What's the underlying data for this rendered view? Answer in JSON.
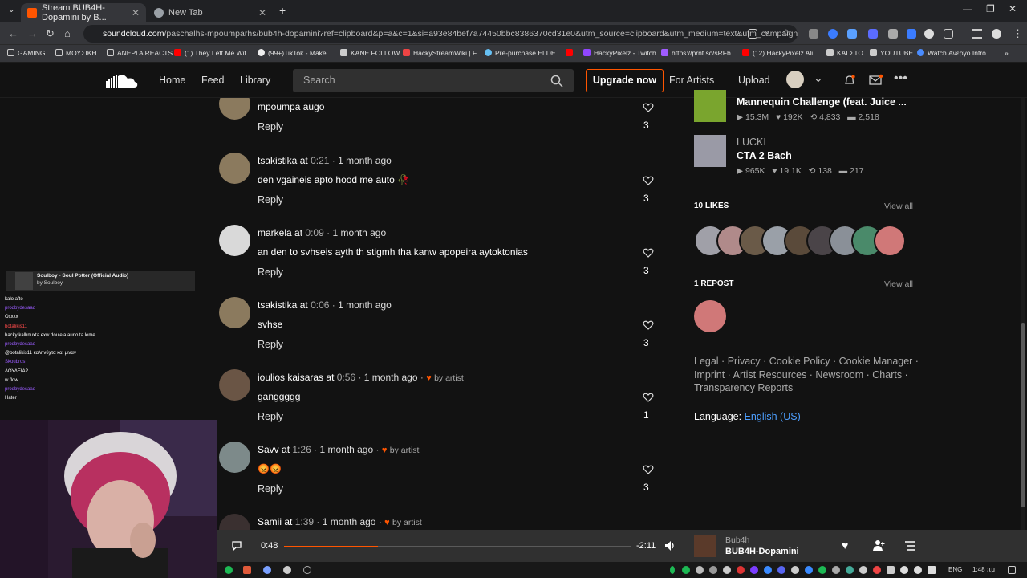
{
  "browser": {
    "tabs": [
      {
        "title": "Stream BUB4H-Dopamini by B...",
        "color": "#ff5500"
      },
      {
        "title": "New Tab",
        "color": "#9aa0a6"
      }
    ],
    "url_prefix": "soundcloud.com",
    "url_rest": "/paschalhs-mpoumparhs/bub4h-dopamini?ref=clipboard&p=a&c=1&si=a93e84bef7a74450bbc8386370cd31e0&utm_source=clipboard&utm_medium=text&utm_campaign..."
  },
  "bookmarks": [
    {
      "label": "GAMING",
      "color": "#666"
    },
    {
      "label": "ΜΟΥΣΙΚΗ",
      "color": "#666"
    },
    {
      "label": "ΑΝΕΡΓΑ REACTS",
      "color": "#666"
    },
    {
      "label": "(1) They Left Me Wit...",
      "color": "#ff0000"
    },
    {
      "label": "(99+)TikTok - Make...",
      "color": "#eee"
    },
    {
      "label": "KANE FOLLOW",
      "color": "#ccc"
    },
    {
      "label": "HackyStreamWiki | F...",
      "color": "#e44"
    },
    {
      "label": "Pre-purchase ELDE...",
      "color": "#1b2838"
    },
    {
      "label": "",
      "color": "#ff0000"
    },
    {
      "label": "HackyPixelz - Twitch",
      "color": "#9146ff"
    },
    {
      "label": "https://prnt.sc/sRFb...",
      "color": "#a05cff"
    },
    {
      "label": "(12) HackyPixelz Ali...",
      "color": "#ff0000"
    },
    {
      "label": "ΚΑΙ ΣΤΟ",
      "color": "#ccc"
    },
    {
      "label": "YOUTUBE",
      "color": "#ccc"
    },
    {
      "label": "Watch Ανεργο Intro...",
      "color": "#4a8cff"
    }
  ],
  "header": {
    "nav": [
      "Home",
      "Feed",
      "Library"
    ],
    "search_placeholder": "Search",
    "upgrade": "Upgrade now",
    "for_artists": "For Artists",
    "upload": "Upload"
  },
  "comments": [
    {
      "user": "",
      "time": "",
      "ago": "",
      "text": "mpoumpa augo",
      "reply": "Reply",
      "likes": "3",
      "by_artist": "",
      "avatar": "#8b7a5e"
    },
    {
      "user": "tsakistika",
      "time": "0:21",
      "ago": "1 month ago",
      "text": "den vgaineis apto hood me auto 🥀",
      "reply": "Reply",
      "likes": "3",
      "by_artist": "",
      "avatar": "#8b7a5e"
    },
    {
      "user": "markela",
      "time": "0:09",
      "ago": "1 month ago",
      "text": "an den to svhseis ayth th stigmh tha kanw apopeira aytoktonias",
      "reply": "Reply",
      "likes": "3",
      "by_artist": "",
      "avatar": "#d9d9d9"
    },
    {
      "user": "tsakistika",
      "time": "0:06",
      "ago": "1 month ago",
      "text": "svhse",
      "reply": "Reply",
      "likes": "3",
      "by_artist": "",
      "avatar": "#8b7a5e"
    },
    {
      "user": "ioulios kaisaras",
      "time": "0:56",
      "ago": "1 month ago",
      "text": "ganggggg",
      "reply": "Reply",
      "likes": "1",
      "by_artist": "by artist",
      "avatar": "#6a5545"
    },
    {
      "user": "Savv",
      "time": "1:26",
      "ago": "1 month ago",
      "text": "😡😡",
      "reply": "Reply",
      "likes": "3",
      "by_artist": "by artist",
      "avatar": "#7d8a8a"
    },
    {
      "user": "Samii",
      "time": "1:39",
      "ago": "1 month ago",
      "text": "",
      "reply": "",
      "likes": "",
      "by_artist": "by artist",
      "avatar": "#3a3030"
    }
  ],
  "at_word": "at",
  "related": [
    {
      "artist": "",
      "title": "Mannequin Challenge (feat. Juice ...",
      "plays": "15.3M",
      "likes": "192K",
      "reposts": "4,833",
      "comments": "2,518",
      "color": "#7aa52e"
    },
    {
      "artist": "LUCKI",
      "title": "CTA 2 Bach",
      "plays": "965K",
      "likes": "19.1K",
      "reposts": "138",
      "comments": "217",
      "color": "#9a9aa6"
    }
  ],
  "likes_header": "10 LIKES",
  "likes_view_all": "View all",
  "like_avatars": [
    "#a0a0a8",
    "#b08a8a",
    "#6a5a48",
    "#9aa0a8",
    "#5a4a3a",
    "#4a4448",
    "#8a9098",
    "#4a8a6a",
    "#d07878"
  ],
  "repost_header": "1 REPOST",
  "repost_view_all": "View all",
  "repost_avatar": "#d07878",
  "footer_links": "Legal · Privacy · Cookie Policy · Cookie Manager · Imprint · Artist Resources · Newsroom · Charts · Transparency Reports",
  "language_label": "Language:",
  "language_value": "English (US)",
  "overlay": {
    "now_playing_title": "Soulboy - Soul Potter (Official Audio)",
    "now_playing_by": "by Soulboy",
    "chat": [
      {
        "name": "",
        "msg": "kalo afto"
      },
      {
        "name": "prodbydesaad",
        "msg": "Oxxxx"
      },
      {
        "name": "botalikis11",
        "msg": "hacky kalhnuxta exw douleia aurio ta leme"
      },
      {
        "name": "prodbydesaad",
        "msg": "@botalikis11 καληνύχτα και μιναν"
      },
      {
        "name": "Skoubros",
        "msg": "ΔΟΥΛΕΙΑ?"
      },
      {
        "name": "",
        "msg": "w flow"
      },
      {
        "name": "prodbydesaad",
        "msg": "Hater"
      }
    ]
  },
  "player": {
    "elapsed": "0:48",
    "remaining": "-2:11",
    "progress": 0.27,
    "artist": "Bub4h",
    "title": "BUB4H-Dopamini"
  },
  "taskbar": {
    "lang": "ENG",
    "time": "1:48 πμ"
  }
}
